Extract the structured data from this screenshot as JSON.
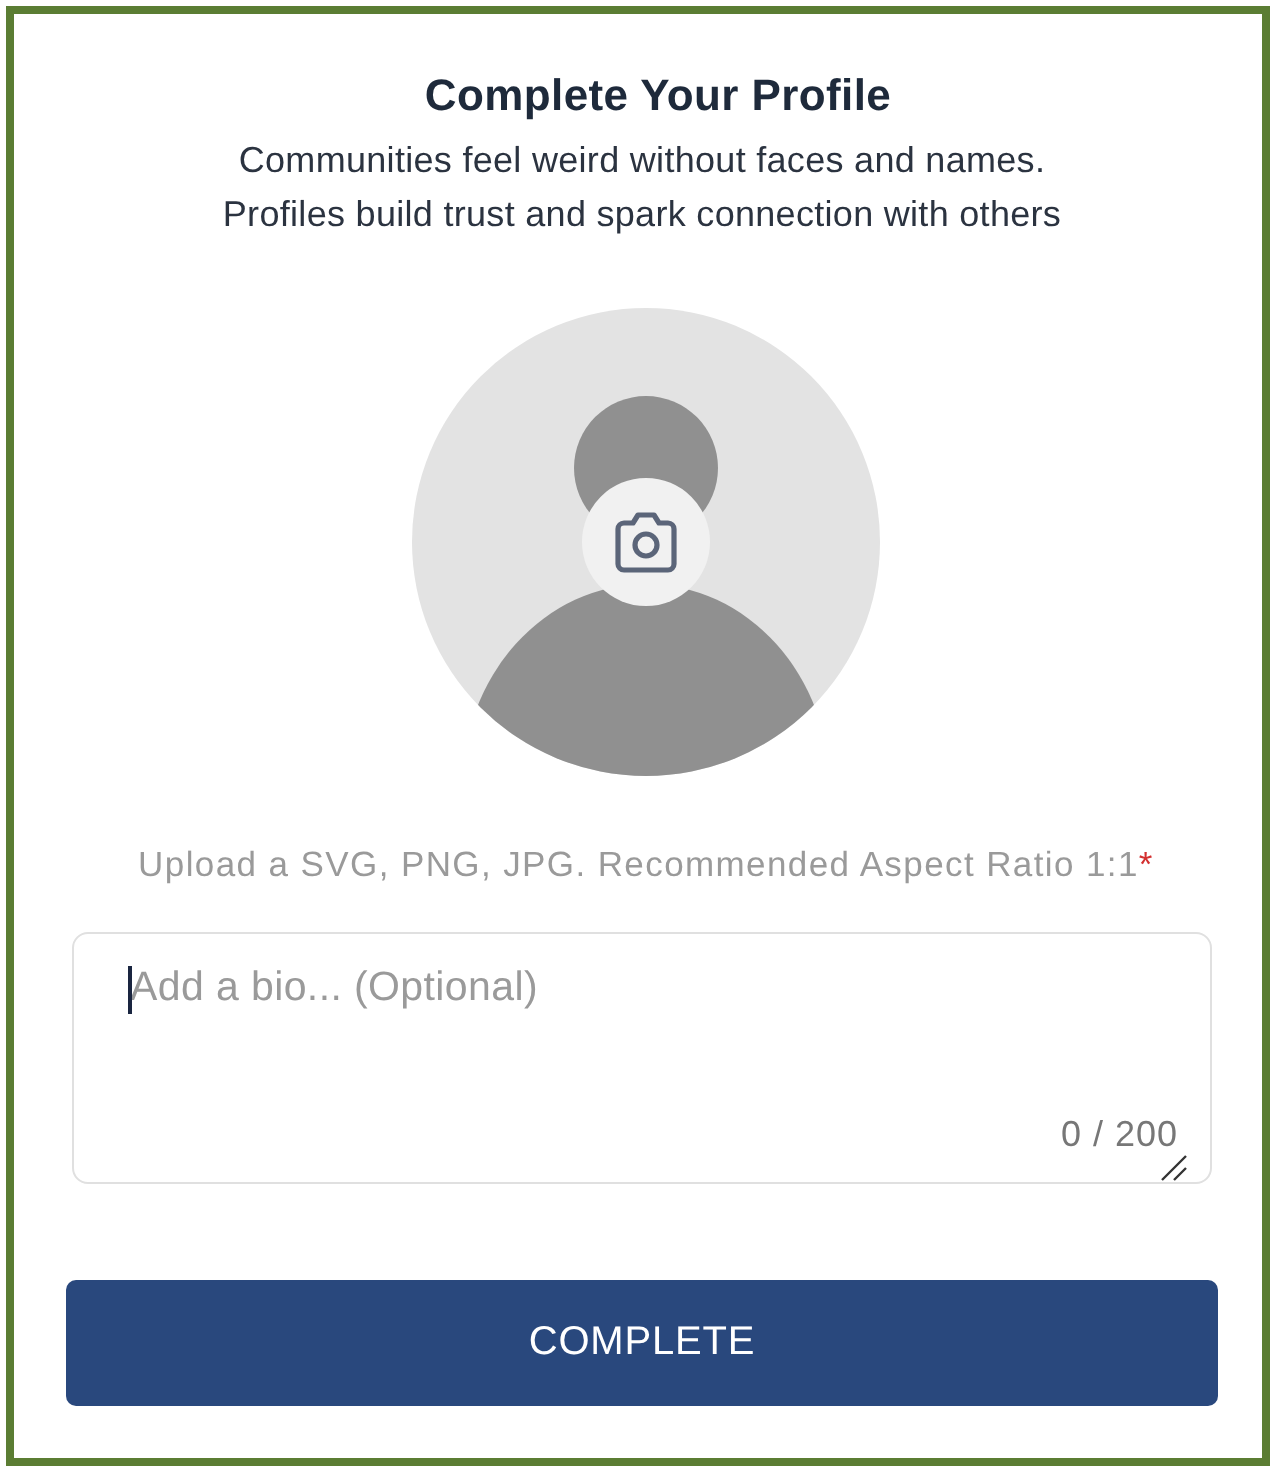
{
  "title": "Complete Your Profile",
  "subtitle_lines": [
    "Communities feel weird without faces and names.",
    "Profiles build trust and spark connection with others"
  ],
  "upload_hint": {
    "text": "Upload a SVG, PNG, JPG. Recommended Aspect Ratio 1:1",
    "required_mark": "*"
  },
  "bio": {
    "placeholder": "Add a bio... (Optional)",
    "focused": true,
    "counter": "0 / 200"
  },
  "submit_button": {
    "label": "COMPLETE"
  }
}
